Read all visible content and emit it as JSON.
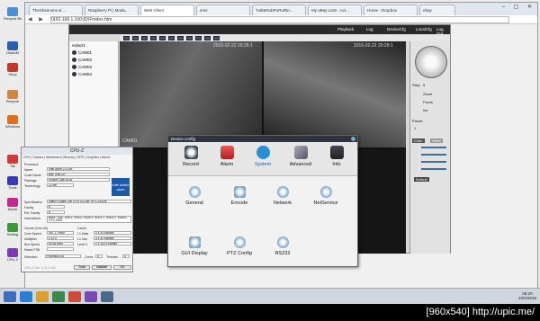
{
  "browser": {
    "tabs": [
      "TheShannons & ...",
      "Raspberry Pi | Moda...",
      "Web Client",
      "ems",
      "Tuilt&RubPoRuRtn...",
      "My eBay Lists - Act...",
      "Home - Dropbox",
      "ebay"
    ],
    "url": "192.168.1.100:82/Fmdex.htm"
  },
  "topbar": {
    "items": [
      "Playback",
      "Log",
      "DeviceCfg",
      "LocalCfg",
      "Log Out"
    ]
  },
  "tree": {
    "root": "redact1",
    "cams": [
      "CAM01",
      "CAM02",
      "CAM03",
      "CAM04"
    ]
  },
  "video": {
    "ts1": "2015-02-22 20:28:1",
    "ts2": "2015-02-22 20:28:1",
    "cam1": "CAM01"
  },
  "ptz": {
    "step": "Step:",
    "step_val": "5",
    "labels": [
      "Zoom",
      "Focus",
      "Iris"
    ],
    "preset": "Preset",
    "preset_val": "1",
    "btns": [
      "Color",
      "Other"
    ],
    "default": "Default"
  },
  "dialog": {
    "title": "Device config",
    "top": [
      "Record",
      "Alarm",
      "System",
      "Advanced",
      "Info"
    ],
    "sub": [
      "General",
      "Encode",
      "Network",
      "NetService",
      "GUI Display",
      "PTZ Config",
      "RS232"
    ]
  },
  "cpuz": {
    "title": "CPU-Z",
    "tabs": [
      "CPU",
      "Caches",
      "Mainboard",
      "Memory",
      "SPD",
      "Graphics",
      "About"
    ],
    "proc": "Processor",
    "rows": [
      [
        "Name",
        "Intel Atom Z3735F"
      ],
      [
        "Code Name",
        "Bay Trail-CR"
      ],
      [
        "Package",
        "Socket 1380 BGA"
      ],
      [
        "Technology",
        "22 nm"
      ],
      [
        "Specification",
        "Intel(R) Atom(TM) CPU Z3735F @ 1.33GHz"
      ],
      [
        "Family",
        "6"
      ],
      [
        "Ext. Family",
        "6"
      ],
      [
        "Instructions",
        "MMX, SSE, SSE2, SSE3, SSSE3, SSE4.1, SSE4.2, EM64T, VT-x, AES"
      ]
    ],
    "clocks": "Clocks (Core #0)",
    "cache": "Cache",
    "crows": [
      [
        "Core Speed",
        "497.17 MHz"
      ],
      [
        "Multiplier",
        "x 11.0"
      ],
      [
        "Bus Speed",
        "83.54 MHz"
      ],
      [
        "Rated FSB",
        ""
      ]
    ],
    "cache_rows": [
      [
        "L1 Data",
        "4 x 24 KBytes"
      ],
      [
        "L1 Inst.",
        "4 x 32 KBytes"
      ],
      [
        "Level 2",
        "2 x 1024 KBytes"
      ]
    ],
    "selection": "Selection",
    "sel_val": "Processor #1",
    "cores": "Cores",
    "cores_val": "4",
    "threads": "Threads",
    "threads_val": "4",
    "footer": "CPU-Z  Ver. 1.71.1.x32",
    "tools": "Tools",
    "validate": "Validate",
    "ok": "OK",
    "intel": "intel inside atom"
  },
  "desktop": {
    "icons": [
      "Recycle Bin",
      "DiskUtil",
      "Shop",
      "Recycle",
      "Windows",
      "Tile",
      "Tools",
      "Movie",
      "Setting",
      "CPU-Z"
    ]
  },
  "taskbar": {
    "time": "05:20",
    "date": "22/2/2015"
  },
  "watermark": "[960x540] http://upic.me/"
}
